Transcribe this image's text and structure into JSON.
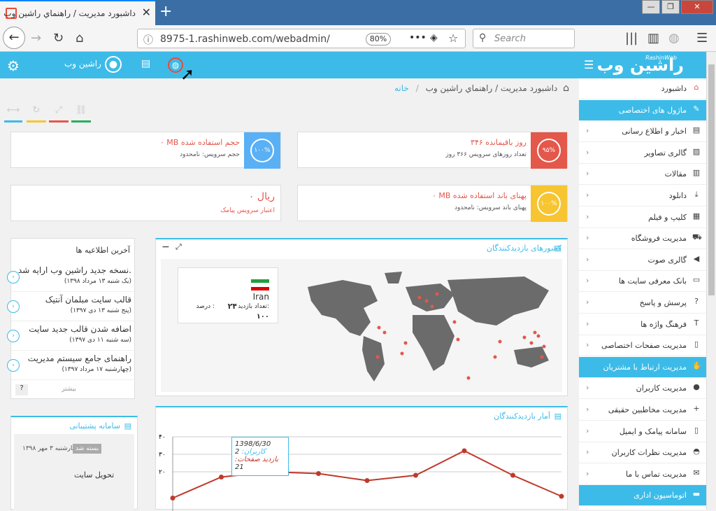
{
  "browser": {
    "tab_title": "داشبورد مدیریت / راهنماي راشین وب",
    "url": "8975-1.rashinweb.com/webadmin/",
    "zoom": "80%",
    "search_placeholder": "Search"
  },
  "header": {
    "logo": "راشین وب",
    "logo_en": "RashinWeb",
    "user_name": "راشین وب"
  },
  "breadcrumb": {
    "home": "خانه",
    "sep": "/",
    "current": "داشبورد مدیریت / راهنماي راشین وب"
  },
  "sidebar": [
    {
      "label": "داشبورد",
      "type": "item",
      "icon": "home-icon"
    },
    {
      "label": "ماژول های اختصاصی",
      "type": "section",
      "icon": "pencil-icon"
    },
    {
      "label": "اخبار و اطلاع رسانی",
      "type": "item",
      "icon": "newspaper-icon"
    },
    {
      "label": "گالری تصاویر",
      "type": "item",
      "icon": "image-icon"
    },
    {
      "label": "مقالات",
      "type": "item",
      "icon": "file-icon"
    },
    {
      "label": "دانلود",
      "type": "item",
      "icon": "download-icon"
    },
    {
      "label": "کلیپ و فیلم",
      "type": "item",
      "icon": "film-icon"
    },
    {
      "label": "مدیریت فروشگاه",
      "type": "item",
      "icon": "cart-icon"
    },
    {
      "label": "گالری صوت",
      "type": "item",
      "icon": "speaker-icon"
    },
    {
      "label": "بانک معرفی سایت ها",
      "type": "item",
      "icon": "monitor-icon"
    },
    {
      "label": "پرسش و پاسخ",
      "type": "item",
      "icon": "question-icon"
    },
    {
      "label": "فرهنگ واژه ها",
      "type": "item",
      "icon": "text-icon"
    },
    {
      "label": "مدیریت صفحات اختصاصی",
      "type": "item",
      "icon": "page-icon"
    },
    {
      "label": "مدیریت ارتباط با مشتریان",
      "type": "section",
      "icon": "handshake-icon"
    },
    {
      "label": "مدیریت کاربران",
      "type": "item",
      "icon": "user-icon"
    },
    {
      "label": "مدیریت مخاطبین حقیقی",
      "type": "item",
      "icon": "user-plus-icon"
    },
    {
      "label": "سامانه پیامک و ایمیل",
      "type": "item",
      "icon": "mobile-icon"
    },
    {
      "label": "مدیریت نظرات کاربران",
      "type": "item",
      "icon": "comments-icon"
    },
    {
      "label": "مدیریت تماس با ما",
      "type": "item",
      "icon": "envelope-icon"
    },
    {
      "label": "اتوماسیون اداری",
      "type": "section",
      "icon": "folder-icon"
    }
  ],
  "stats": {
    "days": {
      "big": "۳۴۶ روز باقیمانده",
      "small": "تعداد روزهای سرویس ۳۶۶ روز",
      "pct": "۹۵%",
      "color": "#e4574b"
    },
    "storage": {
      "big": "۰ MB حجم استفاده شده",
      "small": "حجم سرویس: نامحدود",
      "pct": "۱۰۰%",
      "color": "#5ab0f5"
    },
    "bandwidth": {
      "big": "۰ MB پهنای باند استفاده شده",
      "small": "پهنای باند سرویس: نامحدود",
      "pct": "۱۰۰%",
      "color": "#f7c531"
    },
    "sms": {
      "big": "۰ ریال",
      "small": "اعتبار سرویس پیامک"
    }
  },
  "countries": {
    "title": "کشورهای بازدیدکنندگان",
    "country": "Iran",
    "visits_label": "تعداد بازدید:",
    "visits": "۲۴",
    "percent_label": "درصد :",
    "percent": "۱۰۰"
  },
  "news": {
    "title": "آخرین اطلاعیه ها",
    "more": "بیشتر",
    "items": [
      {
        "title": "نسخه جدید راشین وب ارایه شد.",
        "date": "(یک شنبه ۱۳ مرداد ۱۳۹۸)"
      },
      {
        "title": "قالب سایت مبلمان آنتیک",
        "date": "(پنج شنبه ۱۳ دی ۱۳۹۷)"
      },
      {
        "title": "اضافه شدن قالب جدید سایت",
        "date": "(سه شنبه ۱۱ دی ۱۳۹۷)"
      },
      {
        "title": "راهنمای جامع سیستم مدیریت",
        "date": "(چهارشنبه ۱۷ مرداد ۱۳۹۷)"
      }
    ]
  },
  "support": {
    "title": "سامانه پشتیبانی",
    "status": "بسته شد",
    "date": "چهارشنبه ۳ مهر ۱۳۹۸",
    "ticket": "تحویل سایت"
  },
  "visits": {
    "title": "آمار بازدیدکنندگان",
    "tooltip": {
      "date": "1398/6/30",
      "users_label": "کاربران:",
      "users": "2",
      "pages_label": "بازدید صفحات:",
      "pages": "21"
    }
  },
  "chart_data": {
    "type": "line",
    "ylim": [
      0,
      40
    ],
    "yticks": [
      "۴۰",
      "۳۰",
      "۲۰"
    ],
    "series": [
      {
        "values": [
          5,
          17,
          20,
          19,
          15,
          18,
          32,
          18,
          6
        ]
      }
    ]
  }
}
